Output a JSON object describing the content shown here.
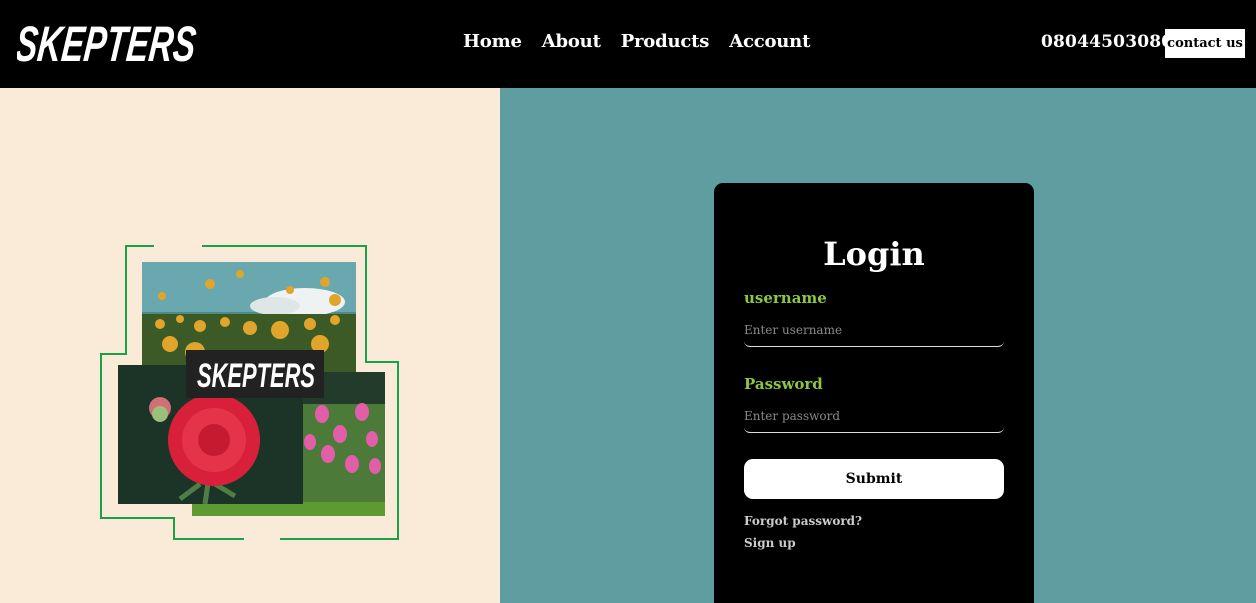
{
  "header": {
    "brand": "SKEPTERS",
    "nav": [
      "Home",
      "About",
      "Products",
      "Account"
    ],
    "phone": "08044503080",
    "contact_label": "contact us"
  },
  "collage": {
    "brand": "SKEPTERS"
  },
  "login": {
    "title": "Login",
    "username_label": "username",
    "username_placeholder": "Enter username",
    "password_label": "Password",
    "password_placeholder": "Enter password",
    "submit_label": "Submit",
    "forgot_label": "Forgot password?",
    "signup_label": "Sign up"
  },
  "colors": {
    "header_bg": "#000000",
    "left_bg": "#f9ebd7",
    "right_bg": "#5f9ea0",
    "accent_green": "#8dc63f",
    "frame_green": "#1aa04a"
  }
}
